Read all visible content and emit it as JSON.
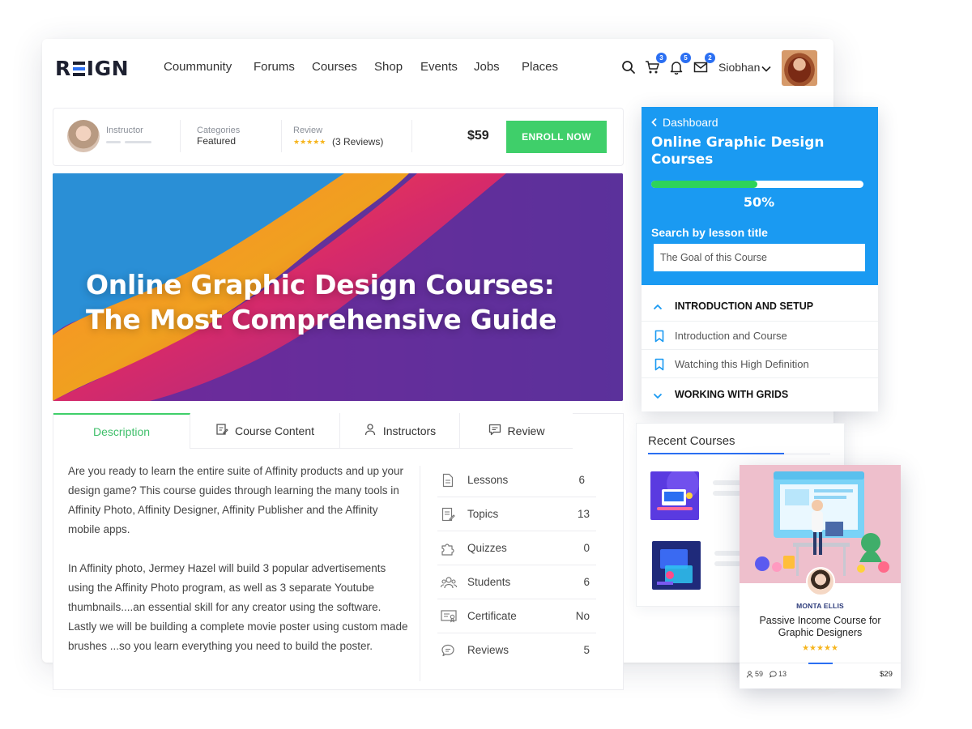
{
  "header": {
    "logo": "REIGN",
    "nav": [
      "Coummunity",
      "Forums",
      "Courses",
      "Shop",
      "Events",
      "Jobs",
      "Places"
    ],
    "cart_count": "3",
    "notifications_count": "5",
    "messages_count": "2",
    "user_name": "Siobhan"
  },
  "course_bar": {
    "instructor_label": "Instructor",
    "categories_label": "Categories",
    "categories_value": "Featured",
    "review_label": "Review",
    "review_stars": "★★★★★",
    "review_count": "(3 Reviews)",
    "price": "$59",
    "enroll_label": "ENROLL NOW"
  },
  "hero": {
    "title": "Online Graphic Design Courses: The Most Comprehensive Guide"
  },
  "tabs": [
    {
      "label": "Description",
      "active": true
    },
    {
      "label": "Course Content"
    },
    {
      "label": "Instructors"
    },
    {
      "label": "Review"
    }
  ],
  "description": {
    "p1": "Are you ready to learn the entire suite of Affinity products and up your design game? This course guides through learning the many tools in Affinity Photo, Affinity Designer, Affinity Publisher and the Affinity mobile apps.",
    "p2": "In Affinity photo, Jermey Hazel will build 3 popular advertisements using the Affinity Photo program, as well as 3 separate Youtube thumbnails....an essential skill for any creator using the software. Lastly we will be building a complete movie poster using custom made brushes ...so you learn everything you need to build the poster."
  },
  "stats": [
    {
      "label": "Lessons",
      "value": "6",
      "icon": "document-icon"
    },
    {
      "label": "Topics",
      "value": "13",
      "icon": "topics-icon"
    },
    {
      "label": "Quizzes",
      "value": "0",
      "icon": "puzzle-icon"
    },
    {
      "label": "Students",
      "value": "6",
      "icon": "students-icon"
    },
    {
      "label": "Certificate",
      "value": "No",
      "icon": "certificate-icon"
    },
    {
      "label": "Reviews",
      "value": "5",
      "icon": "chat-icon"
    }
  ],
  "sidebar": {
    "back_label": "Dashboard",
    "title": "Online Graphic Design Courses",
    "progress_percent": 50,
    "progress_label": "50%",
    "search_label": "Search by lesson title",
    "search_value": "The Goal of this Course",
    "sections": [
      {
        "label": "INTRODUCTION AND SETUP",
        "expanded": true
      },
      {
        "label": "WORKING WITH GRIDS",
        "expanded": false
      }
    ],
    "lessons": [
      "Introduction and Course",
      "Watching this High Definition"
    ]
  },
  "recent": {
    "title": "Recent Courses"
  },
  "course_card": {
    "author": "MONTA ELLIS",
    "title": "Passive Income Course for Graphic Designers",
    "stars": "★★★★★",
    "students": "59",
    "comments": "13",
    "price": "$29"
  },
  "colors": {
    "accent_blue": "#1a9af2",
    "brand_blue": "#2b6ff2",
    "enroll_green": "#3fcf6a",
    "progress_green": "#2ed35a",
    "star_yellow": "#f6b51e"
  }
}
